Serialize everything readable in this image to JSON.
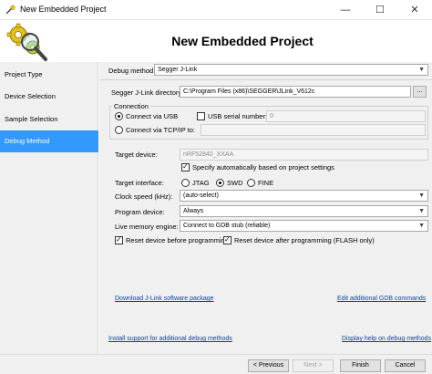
{
  "window": {
    "title": "New Embedded Project",
    "minimize": "—",
    "maximize": "☐",
    "close": "✕"
  },
  "header": {
    "title": "New Embedded Project"
  },
  "sidebar": {
    "items": [
      {
        "label": "Project Type"
      },
      {
        "label": "Device Selection"
      },
      {
        "label": "Sample Selection"
      },
      {
        "label": "Debug Method"
      }
    ]
  },
  "main": {
    "debug_method": {
      "label": "Debug method:",
      "value": "Segger J-Link"
    },
    "jlink_dir": {
      "label": "Segger J-Link directory:",
      "value": "C:\\Program Files (x86)\\SEGGER\\JLink_V612c",
      "browse": "..."
    },
    "connection": {
      "title": "Connection",
      "via_usb": "Connect via USB",
      "usb_serial_label": "USB serial number:",
      "usb_serial_value": "0",
      "via_tcp": "Connect via TCP/IP to:"
    },
    "target_device": {
      "label": "Target device:",
      "value": "nRF52840_XXAA",
      "auto_specify": "Specify automatically based on project settings"
    },
    "target_interface": {
      "label": "Target interface:",
      "options": [
        "JTAG",
        "SWD",
        "FINE"
      ],
      "selected": "SWD"
    },
    "clock_speed": {
      "label": "Clock speed (kHz):",
      "value": "(auto-select)"
    },
    "program_device": {
      "label": "Program device:",
      "value": "Always"
    },
    "live_memory": {
      "label": "Live memory engine:",
      "value": "Connect to GDB stub (reliable)"
    },
    "reset_before": "Reset device before programming",
    "reset_after": "Reset device after programming (FLASH only)",
    "links": {
      "download": "Download J-Link software package",
      "edit_gdb": "Edit additional GDB commands",
      "install_support": "Install support for additional debug methods",
      "display_help": "Display help on debug methods"
    }
  },
  "footer": {
    "previous": "< Previous",
    "next": "Next >",
    "finish": "Finish",
    "cancel": "Cancel"
  },
  "colors": {
    "accent": "#3399ff",
    "link": "#0645ad",
    "panel": "#f0f0f0"
  },
  "icons": {
    "app": "wizard-icon",
    "header": "magnifier-gears-icon"
  }
}
